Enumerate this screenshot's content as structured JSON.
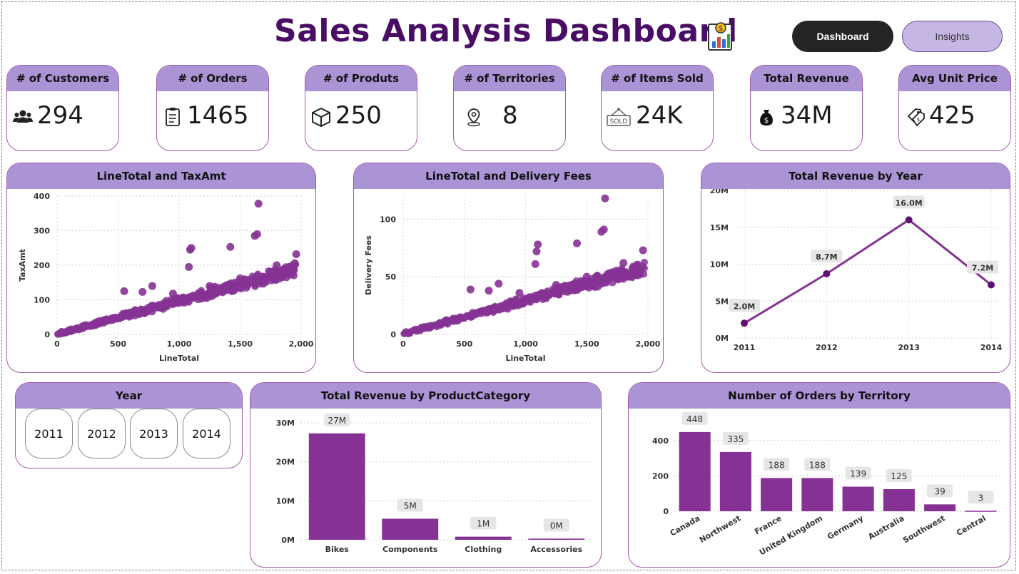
{
  "header": {
    "title": "Sales Analysis Dashboard",
    "nav": [
      {
        "label": "Dashboard",
        "active": true
      },
      {
        "label": "Insights",
        "active": false
      }
    ]
  },
  "kpis": [
    {
      "label": "# of Customers",
      "value": "294",
      "icon": "users-icon"
    },
    {
      "label": "# of Orders",
      "value": "1465",
      "icon": "clipboard-icon"
    },
    {
      "label": "# of Produts",
      "value": "250",
      "icon": "box-icon"
    },
    {
      "label": "# of Territories",
      "value": "8",
      "icon": "location-pin-icon"
    },
    {
      "label": "# of Items Sold",
      "value": "24K",
      "icon": "sold-sign-icon"
    },
    {
      "label": "Total Revenue",
      "value": "34M",
      "icon": "money-bag-icon"
    },
    {
      "label": "Avg Unit Price",
      "value": "425",
      "icon": "price-tag-icon"
    }
  ],
  "colors": {
    "accent": "#ab94d6",
    "title": "#4a0d66",
    "mark": "#863294",
    "line_marker": "#5e1170",
    "border": "#a25aa8"
  },
  "slicer": {
    "title": "Year",
    "options": [
      "2011",
      "2012",
      "2013",
      "2014"
    ]
  },
  "chart_data": [
    {
      "id": "scatter-taxamt",
      "type": "scatter",
      "title": "LineTotal and TaxAmt",
      "xlabel": "LineTotal",
      "ylabel": "TaxAmt",
      "xlim": [
        0,
        2000
      ],
      "ylim": [
        0,
        400
      ],
      "xticks": [
        "0",
        "500",
        "1,000",
        "1,500",
        "2,000"
      ],
      "yticks": [
        "0",
        "100",
        "200",
        "300",
        "400"
      ],
      "grid": true,
      "trend": {
        "x": [
          0,
          2000
        ],
        "y": [
          0,
          190
        ]
      },
      "outliers": [
        {
          "x": 1650,
          "y": 378
        },
        {
          "x": 1640,
          "y": 290
        },
        {
          "x": 1620,
          "y": 285
        },
        {
          "x": 1100,
          "y": 250
        },
        {
          "x": 1090,
          "y": 245
        },
        {
          "x": 1420,
          "y": 253
        },
        {
          "x": 1080,
          "y": 195
        },
        {
          "x": 780,
          "y": 140
        },
        {
          "x": 550,
          "y": 125
        },
        {
          "x": 700,
          "y": 123
        },
        {
          "x": 950,
          "y": 118
        },
        {
          "x": 1500,
          "y": 162
        },
        {
          "x": 1800,
          "y": 200
        },
        {
          "x": 1960,
          "y": 232
        },
        {
          "x": 1250,
          "y": 140
        }
      ]
    },
    {
      "id": "scatter-delivery",
      "type": "scatter",
      "title": "LineTotal and Delivery Fees",
      "xlabel": "LineTotal",
      "ylabel": "Delivery Fees",
      "xlim": [
        0,
        2000
      ],
      "ylim": [
        0,
        120
      ],
      "xticks": [
        "0",
        "500",
        "1,000",
        "1,500",
        "2,000"
      ],
      "yticks": [
        "0",
        "50",
        "100"
      ],
      "ytick_values": [
        0,
        50,
        100
      ],
      "grid": true,
      "trend": {
        "x": [
          0,
          2000
        ],
        "y": [
          0,
          58
        ]
      },
      "outliers": [
        {
          "x": 1650,
          "y": 118
        },
        {
          "x": 1640,
          "y": 91
        },
        {
          "x": 1620,
          "y": 89
        },
        {
          "x": 1100,
          "y": 78
        },
        {
          "x": 1090,
          "y": 72
        },
        {
          "x": 1420,
          "y": 79
        },
        {
          "x": 1080,
          "y": 61
        },
        {
          "x": 780,
          "y": 44
        },
        {
          "x": 550,
          "y": 39
        },
        {
          "x": 700,
          "y": 38
        },
        {
          "x": 950,
          "y": 36
        },
        {
          "x": 1500,
          "y": 50
        },
        {
          "x": 1800,
          "y": 62
        },
        {
          "x": 1960,
          "y": 73
        },
        {
          "x": 1250,
          "y": 43
        }
      ]
    },
    {
      "id": "line-year",
      "type": "line",
      "title": "Total Revenue by Year",
      "categories": [
        "2011",
        "2012",
        "2013",
        "2014"
      ],
      "values": [
        2.0,
        8.7,
        16.0,
        7.2
      ],
      "labels": [
        "2.0M",
        "8.7M",
        "16.0M",
        "7.2M"
      ],
      "ylim": [
        0,
        20
      ],
      "yticks": [
        "0M",
        "5M",
        "10M",
        "15M",
        "20M"
      ],
      "grid": true
    },
    {
      "id": "bar-category",
      "type": "bar",
      "title": "Total Revenue by ProductCategory",
      "categories": [
        "Bikes",
        "Components",
        "Clothing",
        "Accessories"
      ],
      "values": [
        27.3,
        5.4,
        0.8,
        0.3
      ],
      "labels": [
        "27M",
        "5M",
        "1M",
        "0M"
      ],
      "ylim": [
        0,
        30
      ],
      "yticks": [
        "0M",
        "10M",
        "20M",
        "30M"
      ],
      "grid": true
    },
    {
      "id": "bar-territory",
      "type": "bar",
      "title": "Number of Orders by Territory",
      "categories": [
        "Canada",
        "Northwest",
        "France",
        "United Kingdom",
        "Germany",
        "Australia",
        "Southwest",
        "Central"
      ],
      "values": [
        448,
        335,
        188,
        188,
        139,
        125,
        39,
        3
      ],
      "labels": [
        "448",
        "335",
        "188",
        "188",
        "139",
        "125",
        "39",
        "3"
      ],
      "ylim": [
        0,
        500
      ],
      "yticks": [
        "0",
        "200",
        "400"
      ],
      "ytick_values": [
        0,
        200,
        400
      ],
      "grid": true
    }
  ]
}
